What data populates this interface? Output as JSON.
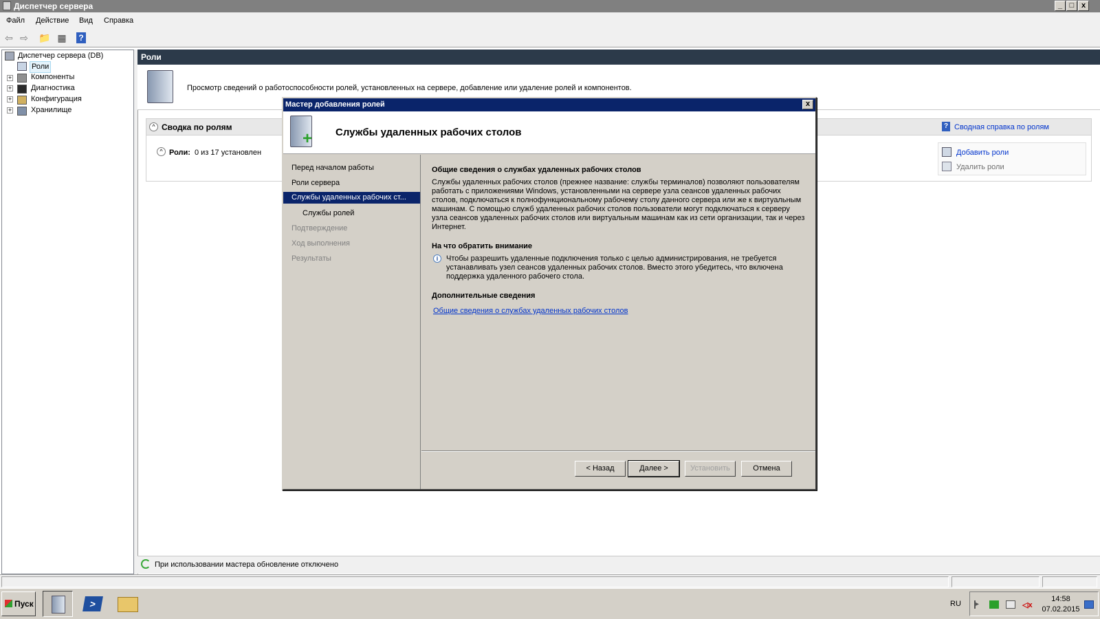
{
  "window": {
    "title": "Диспетчер сервера",
    "minimize": "_",
    "maximize": "□",
    "close": "x"
  },
  "menu": [
    "Файл",
    "Действие",
    "Вид",
    "Справка"
  ],
  "tree": {
    "root": "Диспетчер сервера (DB)",
    "items": [
      {
        "label": "Роли",
        "selected": true
      },
      {
        "label": "Компоненты",
        "expander": "+"
      },
      {
        "label": "Диагностика",
        "expander": "+"
      },
      {
        "label": "Конфигурация",
        "expander": "+"
      },
      {
        "label": "Хранилище",
        "expander": "+"
      }
    ]
  },
  "roles_page": {
    "header": "Роли",
    "description": "Просмотр сведений о работоспособности ролей, установленных на сервере, добавление или удаление ролей и компонентов.",
    "summary_title": "Сводка по ролям",
    "help_link": "Сводная справка по ролям",
    "roles_label": "Роли:",
    "roles_value": "0 из 17 установлен",
    "add_roles": "Добавить роли",
    "remove_roles": "Удалить роли",
    "status": "При использовании мастера обновление отключено"
  },
  "dialog": {
    "title": "Мастер добавления ролей",
    "close": "x",
    "heading": "Службы удаленных рабочих столов",
    "nav": [
      {
        "label": "Перед началом работы",
        "state": "normal"
      },
      {
        "label": "Роли сервера",
        "state": "normal"
      },
      {
        "label": "Службы удаленных рабочих ст...",
        "state": "selected"
      },
      {
        "label": "Службы ролей",
        "state": "normal"
      },
      {
        "label": "Подтверждение",
        "state": "disabled"
      },
      {
        "label": "Ход выполнения",
        "state": "disabled"
      },
      {
        "label": "Результаты",
        "state": "disabled"
      }
    ],
    "section1_title": "Общие сведения о службах удаленных рабочих столов",
    "section1_text": "Службы удаленных рабочих столов (прежнее название: службы терминалов) позволяют пользователям работать с приложениями Windows, установленными на сервере узла сеансов удаленных рабочих столов, подключаться к полнофункциональному рабочему столу данного сервера или же к виртуальным машинам. С помощью служб удаленных рабочих столов пользователи могут подключаться к серверу узла сеансов удаленных рабочих столов или виртуальным машинам как из сети организации, так и через Интернет.",
    "section2_title": "На что обратить внимание",
    "section2_text": "Чтобы разрешить удаленные подключения только с целью администрирования, не требуется устанавливать узел сеансов удаленных рабочих столов. Вместо этого убедитесь, что включена поддержка удаленного рабочего стола.",
    "info_icon_glyph": "i",
    "section3_title": "Дополнительные сведения",
    "section3_link": "Общие сведения о службах удаленных рабочих столов",
    "buttons": {
      "back": "< Назад",
      "next": "Далее >",
      "install": "Установить",
      "cancel": "Отмена"
    }
  },
  "taskbar": {
    "start": "Пуск",
    "lang": "RU",
    "time": "14:58",
    "date": "07.02.2015"
  },
  "colors": {
    "title_active": "#0a246a",
    "roles_header": "#2c3a4a",
    "link": "#0033cc"
  }
}
